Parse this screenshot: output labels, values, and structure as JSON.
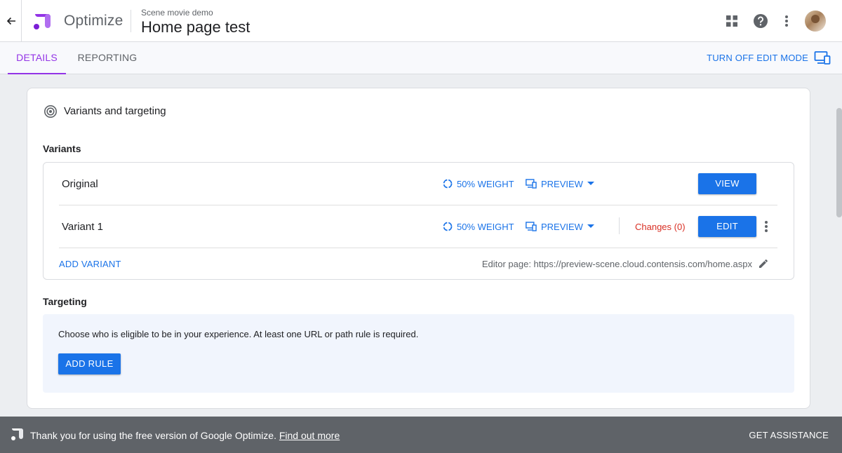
{
  "header": {
    "back_icon": "arrow-back-icon",
    "product_name": "Optimize",
    "container_name": "Scene movie demo",
    "experience_name": "Home page test",
    "icons": [
      "apps-grid-icon",
      "help-icon",
      "more-vert-icon",
      "user-avatar"
    ]
  },
  "tabs": [
    {
      "label": "DETAILS",
      "active": true
    },
    {
      "label": "REPORTING",
      "active": false
    }
  ],
  "edit_mode": {
    "label": "TURN OFF EDIT MODE",
    "icon": "devices-icon"
  },
  "card": {
    "title": "Variants and targeting",
    "icon": "target-icon"
  },
  "variants": {
    "label": "Variants",
    "rows": [
      {
        "name": "Original",
        "weight": "50% WEIGHT",
        "preview": "PREVIEW",
        "action": "VIEW"
      },
      {
        "name": "Variant 1",
        "weight": "50% WEIGHT",
        "preview": "PREVIEW",
        "changes": "Changes (0)",
        "action": "EDIT"
      }
    ],
    "add_variant": "ADD VARIANT",
    "editor_page": "Editor page: https://preview-scene.cloud.contensis.com/home.aspx"
  },
  "targeting": {
    "label": "Targeting",
    "description": "Choose who is eligible to be in your experience. At least one URL or path rule is required.",
    "add_rule": "ADD RULE"
  },
  "footer": {
    "message": "Thank you for using the free version of Google Optimize.",
    "link": "Find out more",
    "assistance": "GET ASSISTANCE"
  },
  "colors": {
    "accent_purple": "#9334e6",
    "primary_blue": "#1a73e8",
    "changes_red": "#d93025",
    "footer_bg": "#5f6368"
  }
}
